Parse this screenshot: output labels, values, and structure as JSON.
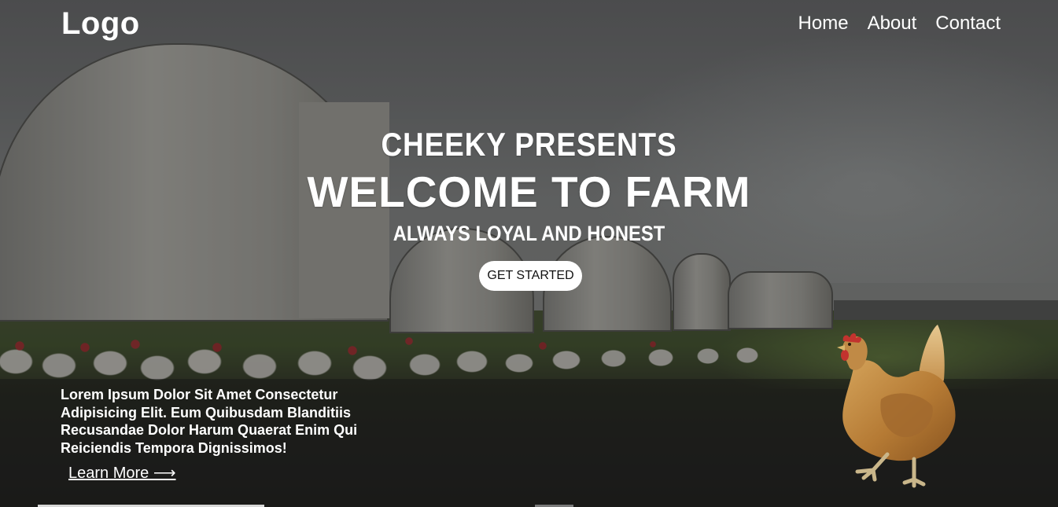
{
  "header": {
    "logo": "Logo",
    "nav": [
      {
        "label": "Home"
      },
      {
        "label": "About"
      },
      {
        "label": "Contact"
      }
    ]
  },
  "hero": {
    "presents": "CHEEKY PRESENTS",
    "title": "WELCOME TO FARM",
    "tagline": "ALWAYS LOYAL AND HONEST",
    "cta_label": "GET STARTED"
  },
  "blurb": {
    "text": "Lorem Ipsum Dolor Sit Amet Consectetur Adipisicing Elit. Eum Quibusdam Blanditiis Recusandae Dolor Harum Quaerat Enim Qui Reiciendis Tempora Dignissimos!",
    "link_label": "Learn More ⟶"
  },
  "colors": {
    "text": "#ffffff",
    "button_bg": "#ffffff",
    "button_text": "#111111"
  },
  "icons": [
    "hen-image",
    "arrow-right-icon"
  ]
}
